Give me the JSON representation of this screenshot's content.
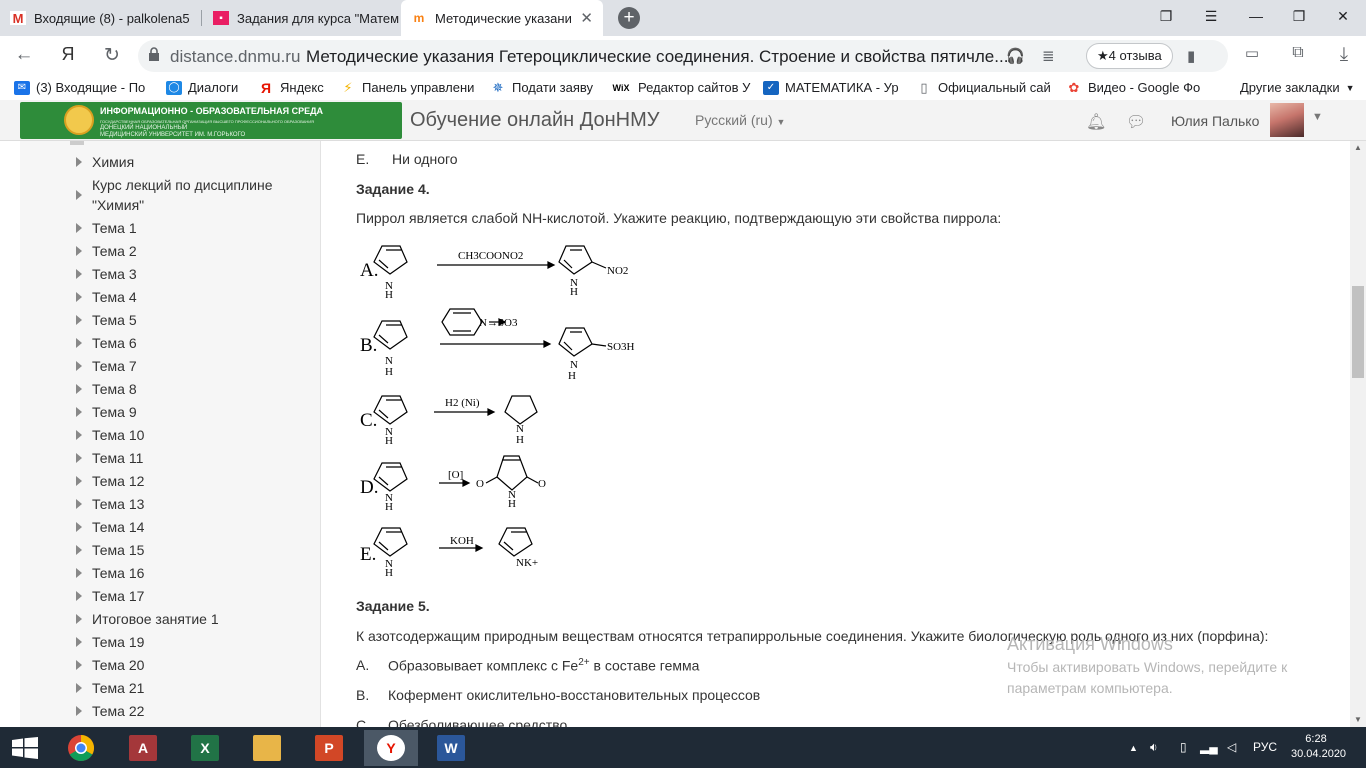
{
  "browser": {
    "tabs": [
      {
        "label": "Входящие (8) - palkolena5"
      },
      {
        "label": "Задания для курса \"Матем"
      },
      {
        "label": "Методические указани"
      }
    ],
    "url_domain": "distance.dnmu.ru",
    "page_title": "Методические указания Гетероциклические соединения. Строение и свойства пятичле...",
    "reviews_label": "★4 отзыва",
    "yandex_logo": "Я",
    "bookmarks": [
      {
        "label": "(3) Входящие - По"
      },
      {
        "label": "Диалоги"
      },
      {
        "label": "Яндекс"
      },
      {
        "label": "Панель управлени"
      },
      {
        "label": "Подати заяву"
      },
      {
        "label": "Редактор сайтов У"
      },
      {
        "label": "МАТЕМАТИКА - Ур"
      },
      {
        "label": "Официальный сай"
      },
      {
        "label": "Видео - Google Фо"
      },
      {
        "label": "Другие закладки"
      }
    ]
  },
  "site": {
    "logo_title": "ИНФОРМАЦИОННО - ОБРАЗОВАТЕЛЬНАЯ СРЕДА",
    "logo_sub1": "ГОСУДАРСТВЕННАЯ ОБРАЗОВАТЕЛЬНАЯ ОРГАНИЗАЦИЯ ВЫСШЕГО ПРОФЕССИОНАЛЬНОГО ОБРАЗОВАНИЯ",
    "logo_sub2": "ДОНЕЦКИЙ НАЦИОНАЛЬНЫЙ",
    "logo_sub3": "МЕДИЦИНСКИЙ УНИВЕРСИТЕТ ИМ. М.ГОРЬКОГО",
    "name": "Обучение онлайн ДонНМУ",
    "language": "Русский (ru)",
    "user_name": "Юлия Палько"
  },
  "sidebar": {
    "items": [
      {
        "label": "Химия"
      },
      {
        "label": "Курс лекций по дисциплине"
      },
      {
        "label": "\"Химия\""
      },
      {
        "label": "Тема 1"
      },
      {
        "label": "Тема 2"
      },
      {
        "label": "Тема 3"
      },
      {
        "label": "Тема 4"
      },
      {
        "label": "Тема 5"
      },
      {
        "label": "Тема 6"
      },
      {
        "label": "Тема 7"
      },
      {
        "label": "Тема 8"
      },
      {
        "label": "Тема 9"
      },
      {
        "label": "Тема 10"
      },
      {
        "label": "Тема 11"
      },
      {
        "label": "Тема 12"
      },
      {
        "label": "Тема 13"
      },
      {
        "label": "Тема 14"
      },
      {
        "label": "Тема 15"
      },
      {
        "label": "Тема 16"
      },
      {
        "label": "Тема 17"
      },
      {
        "label": "Итоговое занятие 1"
      },
      {
        "label": "Тема 19"
      },
      {
        "label": "Тема 20"
      },
      {
        "label": "Тема 21"
      },
      {
        "label": "Тема 22"
      }
    ]
  },
  "content": {
    "prev_option_letter": "E.",
    "prev_option_text": "Ни одного",
    "task4_title": "Задание 4.",
    "task4_question": "Пиррол является слабой NH-кислотой. Укажите реакцию, подтверждающую эти свойства пиррола:",
    "reactions": [
      {
        "letter": "A.",
        "reagent": "CH3COONO2",
        "product_group": "NO2"
      },
      {
        "letter": "B.",
        "reagent": "N→SO3",
        "product_group": "SO3H"
      },
      {
        "letter": "C.",
        "reagent": "H2 (Ni)",
        "product_group": ""
      },
      {
        "letter": "D.",
        "reagent": "[O]",
        "product_group": "O O"
      },
      {
        "letter": "E.",
        "reagent": "KOH",
        "product_group": "NK+"
      }
    ],
    "task5_title": "Задание 5.",
    "task5_question": "К азотсодержащим природным веществам относятся тетрапиррольные соединения. Укажите биологическую роль одного из них (порфина):",
    "task5_options": [
      {
        "letter": "A.",
        "text_before": "Образовывает комплекс с Fe",
        "sup": "2+",
        "text_after": "в составе гемма"
      },
      {
        "letter": "B.",
        "text": "Кофермент окислительно-восстановительных процессов"
      },
      {
        "letter": "C.",
        "text": "Обезболивающее средство"
      }
    ]
  },
  "watermark": {
    "line1": "Активация Windows",
    "line2": "Чтобы активировать Windows, перейдите к параметрам компьютера."
  },
  "taskbar": {
    "lang": "РУС",
    "time": "6:28",
    "date": "30.04.2020"
  }
}
